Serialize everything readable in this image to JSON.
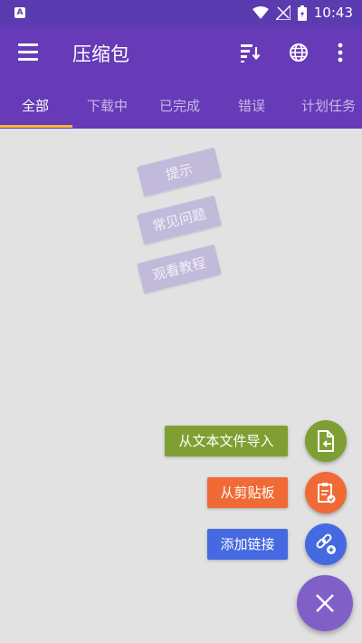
{
  "status_bar": {
    "time": "10:43",
    "notification_icon": "A"
  },
  "app_bar": {
    "title": "压缩包",
    "icons": [
      "menu-icon",
      "sort-icon",
      "globe-icon",
      "more-icon"
    ]
  },
  "tabs": [
    {
      "label": "全部",
      "active": true
    },
    {
      "label": "下载中",
      "active": false
    },
    {
      "label": "已完成",
      "active": false
    },
    {
      "label": "错误",
      "active": false
    },
    {
      "label": "计划任务",
      "active": false
    }
  ],
  "hint_cards": [
    {
      "label": "提示"
    },
    {
      "label": "常见问题"
    },
    {
      "label": "观看教程"
    }
  ],
  "fab_actions": [
    {
      "label": "从文本文件导入",
      "color": "#7f9f33",
      "icon": "file-import-icon"
    },
    {
      "label": "从剪贴板",
      "color": "#f06a35",
      "icon": "clipboard-icon"
    },
    {
      "label": "添加链接",
      "color": "#4569e0",
      "icon": "add-link-icon"
    }
  ],
  "colors": {
    "primary": "#673ab7",
    "status_bar": "#5b3bb0",
    "indicator": "#f7b733",
    "fab_main": "#8060c8"
  }
}
